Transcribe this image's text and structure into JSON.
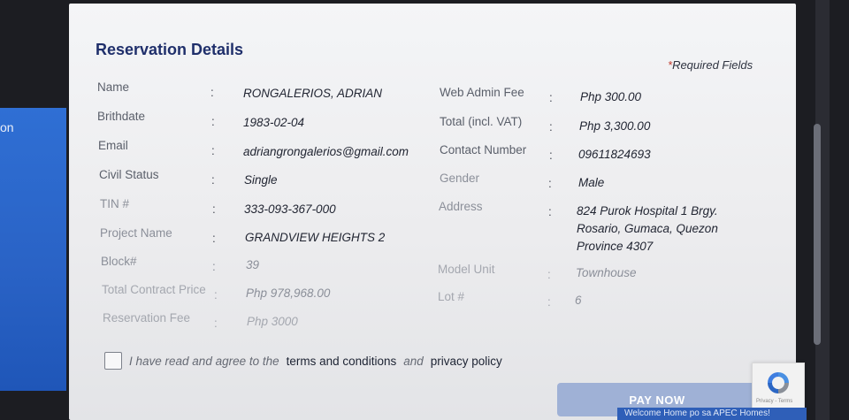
{
  "background": {
    "left_text": "on"
  },
  "modal": {
    "title": "Reservation Details",
    "required_star": "*",
    "required_text": "Required Fields",
    "left_fields": [
      {
        "label": "Name",
        "value": "RONGALERIOS, ADRIAN"
      },
      {
        "label": "Brithdate",
        "value": "1983-02-04"
      },
      {
        "label": "Email",
        "value": "adriangrongalerios@gmail.com"
      },
      {
        "label": "Civil Status",
        "value": "Single"
      },
      {
        "label": "TIN #",
        "value": "333-093-367-000"
      },
      {
        "label": "Project Name",
        "value": "GRANDVIEW HEIGHTS 2"
      },
      {
        "label": "Block#",
        "value": "39"
      },
      {
        "label": "Total Contract Price",
        "value": "Php 978,968.00"
      },
      {
        "label": "Reservation Fee",
        "value": "Php 3000"
      }
    ],
    "right_fields": [
      {
        "label": "Web Admin Fee",
        "value": "Php 300.00"
      },
      {
        "label": "Total (incl. VAT)",
        "value": "Php 3,300.00"
      },
      {
        "label": "Contact Number",
        "value": "09611824693"
      },
      {
        "label": "Gender",
        "value": "Male"
      },
      {
        "label": "Address",
        "value": "824 Purok Hospital 1 Brgy. Rosario, Gumaca, Quezon Province 4307"
      },
      {
        "label": "Model Unit",
        "value": "Townhouse"
      },
      {
        "label": "Lot #",
        "value": "6"
      }
    ],
    "colon": ":",
    "agreement": {
      "prefix": "I have read and agree to the",
      "terms_link": "terms and conditions",
      "and": "and",
      "privacy_link": "privacy policy"
    },
    "pay_button": "PAY NOW"
  },
  "recaptcha": {
    "links": "Privacy - Terms"
  },
  "chat_bar": {
    "text": "Welcome Home po sa APEC Homes!"
  }
}
